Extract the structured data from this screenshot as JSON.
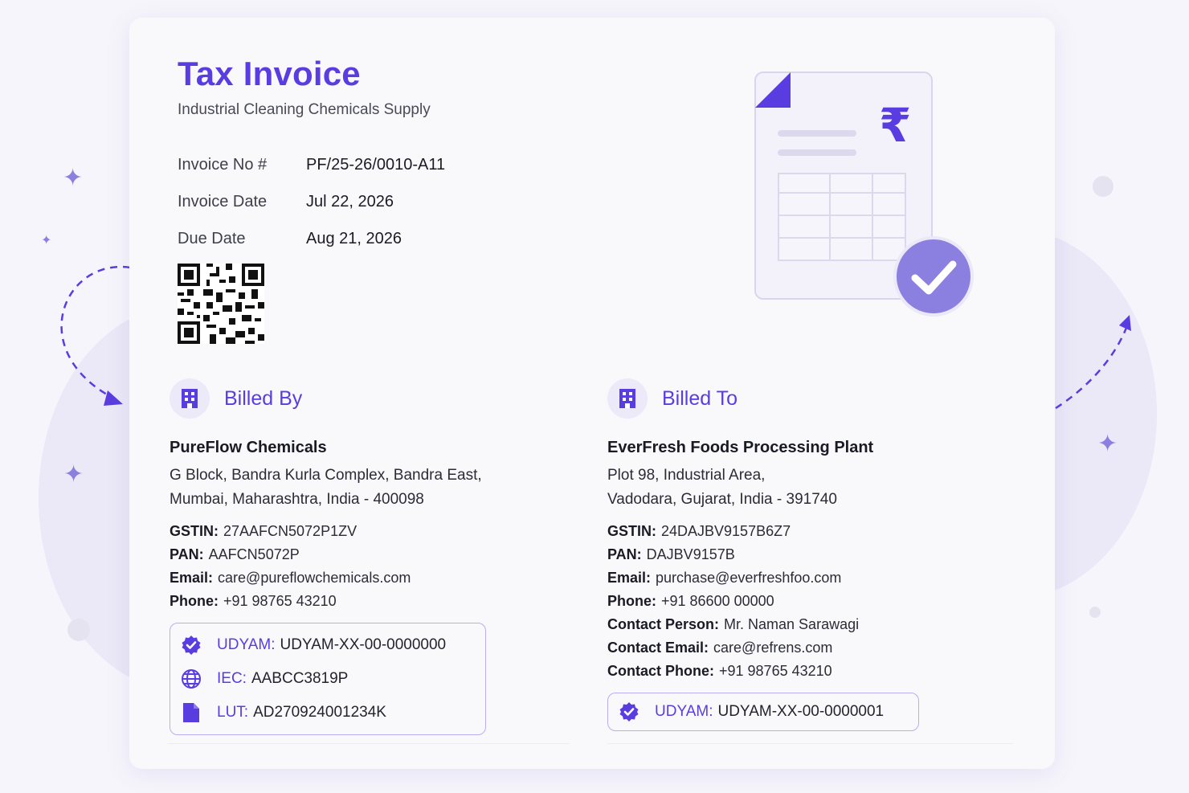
{
  "header": {
    "title": "Tax Invoice",
    "subtitle": "Industrial Cleaning Chemicals Supply"
  },
  "meta": [
    {
      "label": "Invoice No #",
      "value": "PF/25-26/0010-A11"
    },
    {
      "label": "Invoice Date",
      "value": "Jul 22, 2026"
    },
    {
      "label": "Due Date",
      "value": "Aug 21, 2026"
    }
  ],
  "illustration": {
    "currency_symbol": "₹"
  },
  "billed_by": {
    "heading": "Billed By",
    "name": "PureFlow Chemicals",
    "address_line1": "G Block, Bandra Kurla Complex, Bandra East,",
    "address_line2": "Mumbai, Maharashtra, India - 400098",
    "fields": [
      {
        "label": "GSTIN:",
        "value": "27AAFCN5072P1ZV"
      },
      {
        "label": "PAN:",
        "value": "AAFCN5072P"
      },
      {
        "label": "Email:",
        "value": "care@pureflowchemicals.com"
      },
      {
        "label": "Phone:",
        "value": "+91 98765 43210"
      }
    ],
    "badges": [
      {
        "icon": "verified-badge-icon",
        "label": "UDYAM:",
        "value": "UDYAM-XX-00-0000000"
      },
      {
        "icon": "globe-icon",
        "label": "IEC:",
        "value": "AABCC3819P"
      },
      {
        "icon": "document-icon",
        "label": "LUT:",
        "value": "AD270924001234K"
      }
    ]
  },
  "billed_to": {
    "heading": "Billed To",
    "name": "EverFresh Foods Processing Plant",
    "address_line1": "Plot 98, Industrial Area,",
    "address_line2": "Vadodara, Gujarat, India - 391740",
    "fields": [
      {
        "label": "GSTIN:",
        "value": "24DAJBV9157B6Z7"
      },
      {
        "label": "PAN:",
        "value": "DAJBV9157B"
      },
      {
        "label": "Email:",
        "value": "purchase@everfreshfoo.com"
      },
      {
        "label": "Phone:",
        "value": "+91 86600 00000"
      },
      {
        "label": "Contact Person:",
        "value": "Mr. Naman Sarawagi"
      },
      {
        "label": "Contact Email:",
        "value": "care@refrens.com"
      },
      {
        "label": "Contact Phone:",
        "value": "+91 98765 43210"
      }
    ],
    "badges": [
      {
        "icon": "verified-badge-icon",
        "label": "UDYAM:",
        "value": "UDYAM-XX-00-0000001"
      }
    ]
  },
  "colors": {
    "accent": "#5a3de0",
    "accent_light": "#8b7fe0",
    "background": "#f6f5fb",
    "card": "#f9f9fc"
  }
}
